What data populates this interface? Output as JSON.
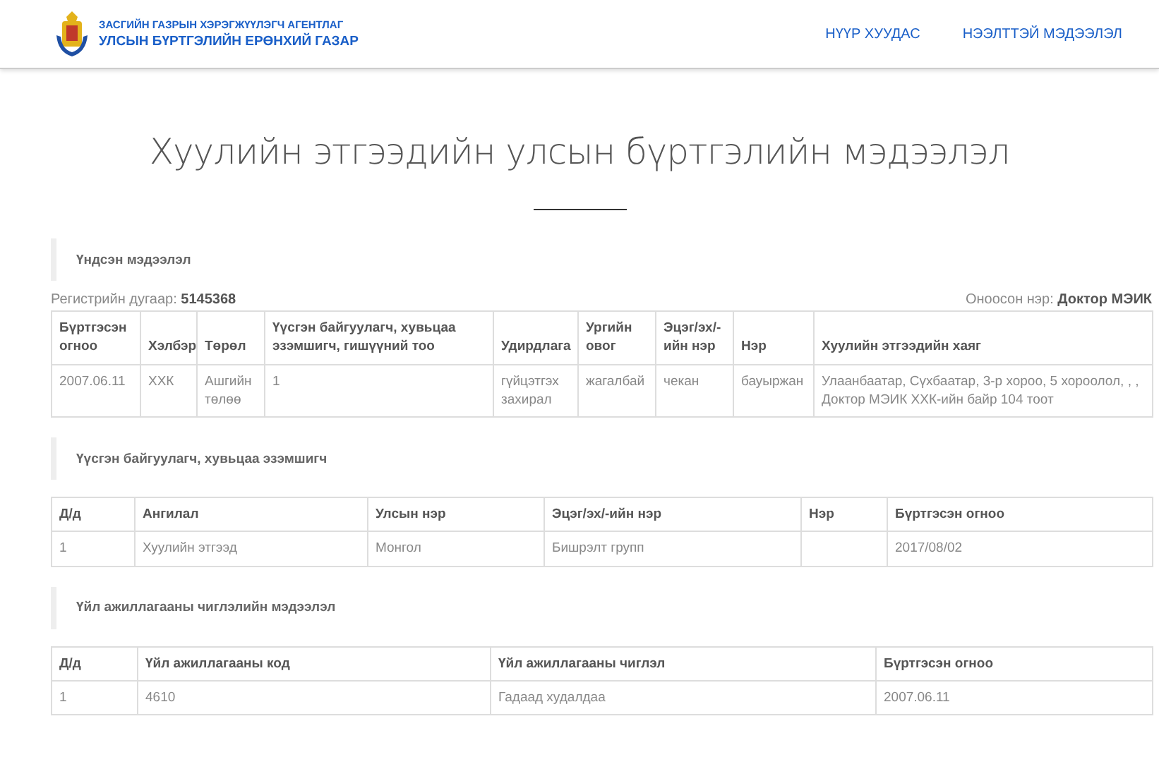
{
  "header": {
    "org_line_1": "ЗАСГИЙН ГАЗРЫН ХЭРЭГЖҮҮЛЭГЧ АГЕНТЛАГ",
    "org_line_2": "УЛСЫН БҮРТГЭЛИЙН ЕРӨНХИЙ ГАЗАР",
    "nav": [
      {
        "label": "НҮҮР ХУУДАС"
      },
      {
        "label": "НЭЭЛТТЭЙ МЭДЭЭЛЭЛ"
      }
    ]
  },
  "title": "Хуулийн этгээдийн улсын бүртгэлийн мэдээлэл",
  "sections": [
    {
      "heading": "Үндсэн мэдээлэл",
      "meta_left": {
        "label": "Регистрийн дугаар:",
        "value": "5145368"
      },
      "meta_right": {
        "label": "Оноосон нэр:",
        "value": "Доктор МЭИК"
      },
      "columns": [
        "Бүртгэсэн огноо",
        "Хэлбэр",
        "Төрөл",
        "Үүсгэн байгуулагч, хувьцаа эзэмшигч, гишүүний тоо",
        "Удирдлага",
        "Ургийн овог",
        "Эцэг/эх/-ийн нэр",
        "Нэр",
        "Хуулийн этгээдийн хаяг"
      ],
      "rows": [
        [
          "2007.06.11",
          "ХХК",
          "Ашгийн төлөө",
          "1",
          "гүйцэтгэх захирал",
          "жагалбай",
          "чекан",
          "бауыржан",
          "Улаанбаатар, Сүхбаатар, 3-р хороо, 5 хороолол, , , Доктор МЭИК ХХК-ийн байр 104 тоот"
        ]
      ]
    },
    {
      "heading": "Үүсгэн байгуулагч, хувьцаа эзэмшигч",
      "columns": [
        "Д/д",
        "Ангилал",
        "Улсын нэр",
        "Эцэг/эх/-ийн нэр",
        "Нэр",
        "Бүртгэсэн огноо"
      ],
      "rows": [
        [
          "1",
          "Хуулийн этгээд",
          "Монгол",
          "Бишрэлт групп",
          "",
          "2017/08/02"
        ]
      ]
    },
    {
      "heading": "Үйл ажиллагааны чиглэлийн мэдээлэл",
      "columns": [
        "Д/д",
        "Үйл ажиллагааны код",
        "Үйл ажиллагааны чиглэл",
        "Бүртгэсэн огноо"
      ],
      "rows": [
        [
          "1",
          "4610",
          "Гадаад худалдаа",
          "2007.06.11"
        ]
      ]
    }
  ]
}
